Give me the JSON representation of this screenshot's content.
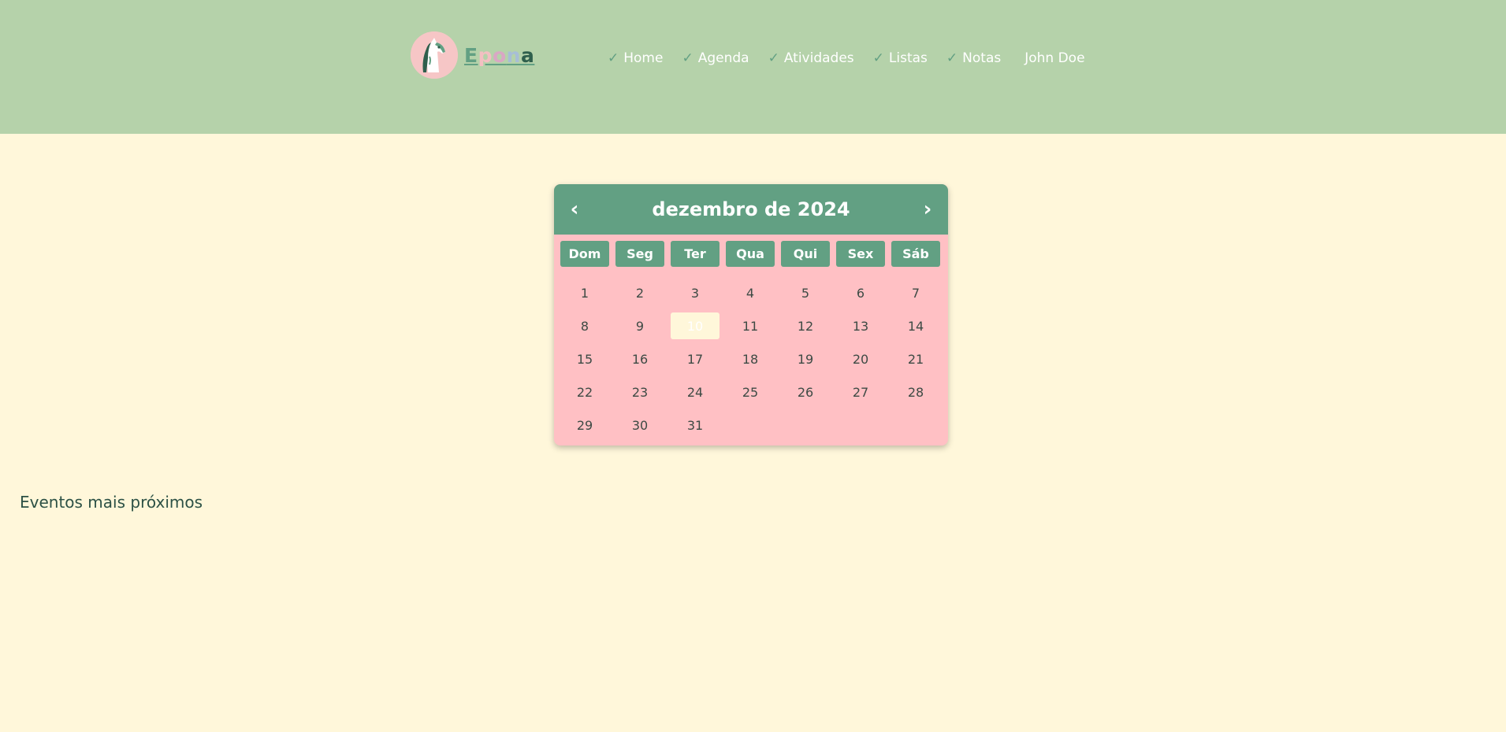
{
  "header": {
    "logo_letters": [
      "E",
      "p",
      "o",
      "n",
      "a"
    ],
    "nav": [
      {
        "label": "Home"
      },
      {
        "label": "Agenda"
      },
      {
        "label": "Atividades"
      },
      {
        "label": "Listas"
      },
      {
        "label": "Notas"
      }
    ],
    "nav_check_icon": "✓",
    "user": "John Doe"
  },
  "calendar": {
    "title": "dezembro de 2024",
    "prev_icon": "‹",
    "next_icon": "›",
    "weekdays": [
      "Dom",
      "Seg",
      "Ter",
      "Qua",
      "Qui",
      "Sex",
      "Sáb"
    ],
    "days": [
      "1",
      "2",
      "3",
      "4",
      "5",
      "6",
      "7",
      "8",
      "9",
      "10",
      "11",
      "12",
      "13",
      "14",
      "15",
      "16",
      "17",
      "18",
      "19",
      "20",
      "21",
      "22",
      "23",
      "24",
      "25",
      "26",
      "27",
      "28",
      "29",
      "30",
      "31"
    ],
    "today": "10"
  },
  "events": {
    "title": "Eventos mais próximos"
  },
  "colors": {
    "header_bg": "#b5d2aa",
    "page_bg": "#fff7da",
    "accent_green": "#62a083",
    "calendar_bg": "#ffc0c4"
  }
}
